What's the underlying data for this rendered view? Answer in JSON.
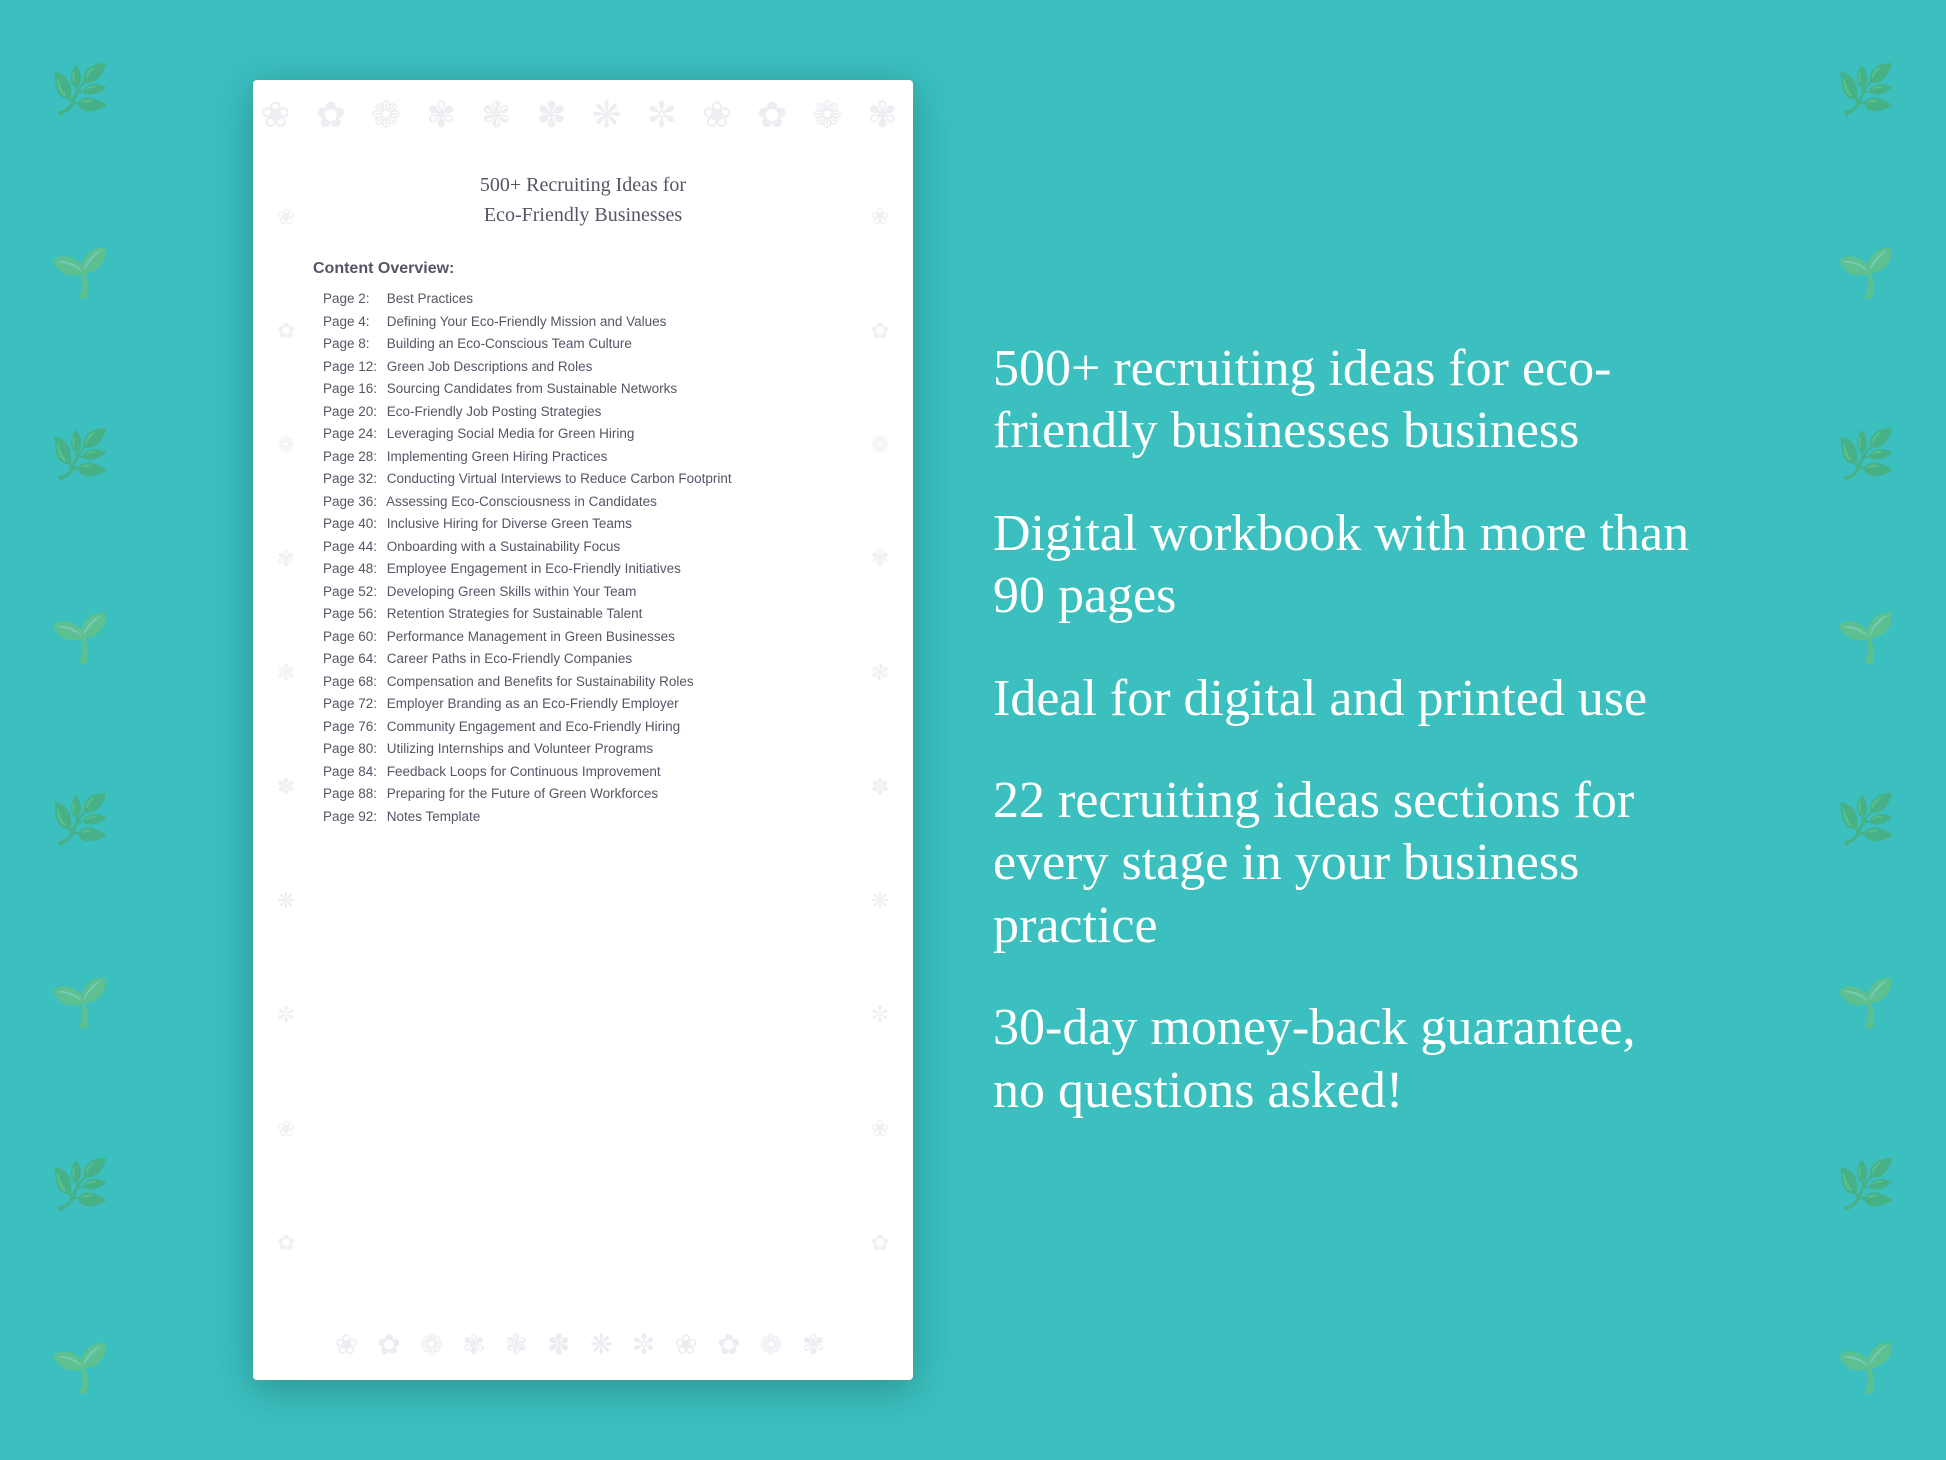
{
  "background": {
    "color": "#3bbfbf"
  },
  "document": {
    "title_line1": "500+ Recruiting Ideas for",
    "title_line2": "Eco-Friendly Businesses",
    "content_overview_label": "Content Overview:",
    "toc": [
      {
        "page": "Page  2:",
        "title": "Best Practices"
      },
      {
        "page": "Page  4:",
        "title": "Defining Your Eco-Friendly Mission and Values"
      },
      {
        "page": "Page  8:",
        "title": "Building an Eco-Conscious Team Culture"
      },
      {
        "page": "Page 12:",
        "title": "Green Job Descriptions and Roles"
      },
      {
        "page": "Page 16:",
        "title": "Sourcing Candidates from Sustainable Networks"
      },
      {
        "page": "Page 20:",
        "title": "Eco-Friendly Job Posting Strategies"
      },
      {
        "page": "Page 24:",
        "title": "Leveraging Social Media for Green Hiring"
      },
      {
        "page": "Page 28:",
        "title": "Implementing Green Hiring Practices"
      },
      {
        "page": "Page 32:",
        "title": "Conducting Virtual Interviews to Reduce Carbon Footprint"
      },
      {
        "page": "Page 36:",
        "title": "Assessing Eco-Consciousness in Candidates"
      },
      {
        "page": "Page 40:",
        "title": "Inclusive Hiring for Diverse Green Teams"
      },
      {
        "page": "Page 44:",
        "title": "Onboarding with a Sustainability Focus"
      },
      {
        "page": "Page 48:",
        "title": "Employee Engagement in Eco-Friendly Initiatives"
      },
      {
        "page": "Page 52:",
        "title": "Developing Green Skills within Your Team"
      },
      {
        "page": "Page 56:",
        "title": "Retention Strategies for Sustainable Talent"
      },
      {
        "page": "Page 60:",
        "title": "Performance Management in Green Businesses"
      },
      {
        "page": "Page 64:",
        "title": "Career Paths in Eco-Friendly Companies"
      },
      {
        "page": "Page 68:",
        "title": "Compensation and Benefits for Sustainability Roles"
      },
      {
        "page": "Page 72:",
        "title": "Employer Branding as an Eco-Friendly Employer"
      },
      {
        "page": "Page 76:",
        "title": "Community Engagement and Eco-Friendly Hiring"
      },
      {
        "page": "Page 80:",
        "title": "Utilizing Internships and Volunteer Programs"
      },
      {
        "page": "Page 84:",
        "title": "Feedback Loops for Continuous Improvement"
      },
      {
        "page": "Page 88:",
        "title": "Preparing for the Future of Green Workforces"
      },
      {
        "page": "Page 92:",
        "title": "Notes Template"
      }
    ]
  },
  "features": [
    {
      "id": "feature-1",
      "text": "500+ recruiting ideas for eco-friendly businesses business"
    },
    {
      "id": "feature-2",
      "text": "Digital workbook with more than 90 pages"
    },
    {
      "id": "feature-3",
      "text": "Ideal for digital and printed use"
    },
    {
      "id": "feature-4",
      "text": "22 recruiting ideas sections for every stage in your business practice"
    },
    {
      "id": "feature-5",
      "text": "30-day money-back guarantee, no questions asked!"
    }
  ],
  "floral_symbols": [
    "❀",
    "✿",
    "❁",
    "✾",
    "❃",
    "✽",
    "❋",
    "✼",
    "❀",
    "✿",
    "❁",
    "✾",
    "❃",
    "✽"
  ]
}
